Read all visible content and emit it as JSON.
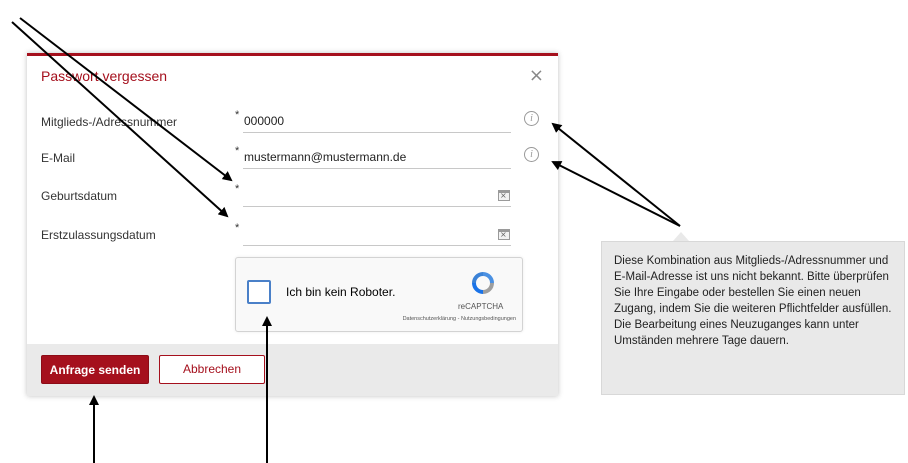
{
  "dialog": {
    "title": "Passwort vergessen",
    "close_symbol": "×",
    "required_marker": "*",
    "fields": [
      {
        "label": "Mitglieds-/Adressnummer",
        "value": "000000",
        "icon": "info-icon"
      },
      {
        "label": "E-Mail",
        "value": "mustermann@mustermann.de",
        "icon": "info-icon"
      },
      {
        "label": "Geburtsdatum",
        "value": "",
        "icon": "calendar-icon"
      },
      {
        "label": "Erstzulassungsdatum",
        "value": "",
        "icon": "calendar-icon"
      }
    ],
    "captcha": {
      "label": "Ich bin kein Roboter.",
      "brand": "reCAPTCHA",
      "links": "Datenschutzerklärung - Nutzungsbedingungen"
    },
    "buttons": {
      "submit": "Anfrage senden",
      "cancel": "Abbrechen"
    }
  },
  "tooltip": {
    "text": "Diese Kombination aus Mitglieds-/Adressnummer und E-Mail-Adresse ist uns nicht bekannt. Bitte überprüfen Sie Ihre Eingabe oder bestellen Sie einen neuen Zugang, indem Sie die weiteren Pflichtfelder ausfüllen. Die Bearbeitung eines Neuzuganges kann unter Umständen mehrere Tage dauern."
  },
  "colors": {
    "accent": "#a5101d",
    "footer_bg": "#eaeaea",
    "tooltip_bg": "#e9e9e9",
    "annotation_arrows": "#000000"
  }
}
